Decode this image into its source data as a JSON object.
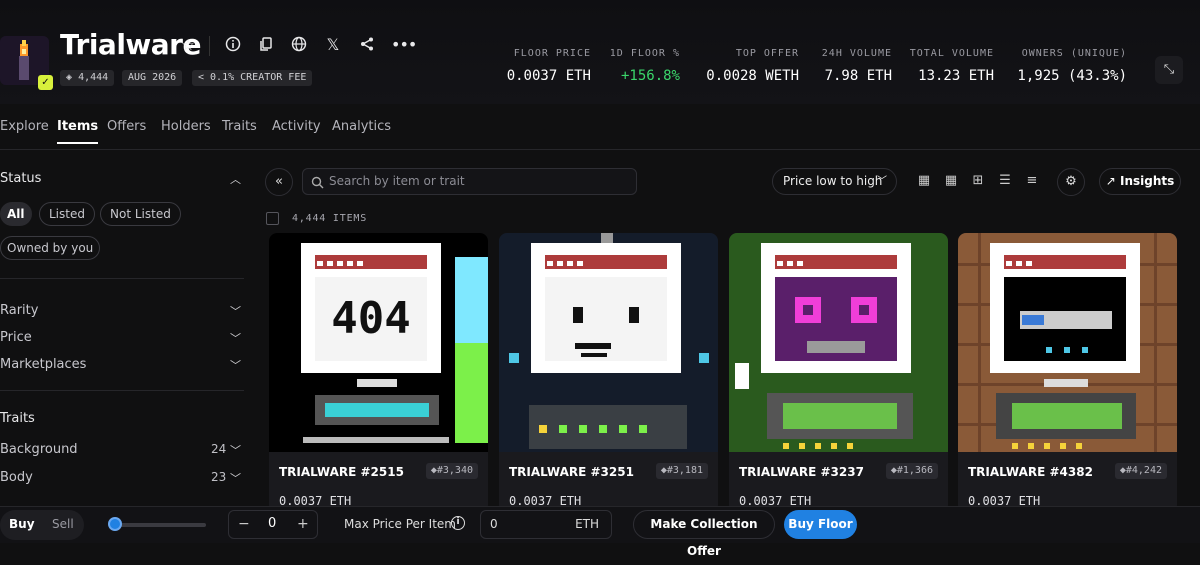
{
  "collection": {
    "title": "Trialware",
    "items_pill": "4,444",
    "date_pill": "AUG 2026",
    "fee_pill": "< 0.1% CREATOR FEE",
    "verify_badge": "✓"
  },
  "stats": [
    {
      "label": "FLOOR PRICE",
      "value": "0.0037 ETH",
      "color": "#ffffff"
    },
    {
      "label": "1D FLOOR %",
      "value": "+156.8%",
      "color": "#3bd66b"
    },
    {
      "label": "TOP OFFER",
      "value": "0.0028 WETH",
      "color": "#ffffff"
    },
    {
      "label": "24H VOLUME",
      "value": "7.98 ETH",
      "color": "#ffffff"
    },
    {
      "label": "TOTAL VOLUME",
      "value": "13.23 ETH",
      "color": "#ffffff"
    },
    {
      "label": "OWNERS (UNIQUE)",
      "value": "1,925 (43.3%)",
      "color": "#ffffff"
    }
  ],
  "header_icons": [
    "star-icon",
    "info-icon",
    "copy-icon",
    "globe-icon",
    "x-logo-icon",
    "share-icon",
    "more-icon"
  ],
  "tabs": [
    "Explore",
    "Items",
    "Offers",
    "Holders",
    "Traits",
    "Activity",
    "Analytics"
  ],
  "active_tab": "Items",
  "sidebar": {
    "status_title": "Status",
    "status_chips": [
      "All",
      "Listed",
      "Not Listed",
      "Owned by you"
    ],
    "filters": [
      "Rarity",
      "Price",
      "Marketplaces"
    ],
    "traits_title": "Traits",
    "traits": [
      {
        "label": "Background",
        "count": "24"
      },
      {
        "label": "Body",
        "count": "23"
      }
    ]
  },
  "toolbar": {
    "search_placeholder": "Search by item or trait",
    "sort_label": "Price low to high",
    "insights_label": "Insights",
    "item_count": "4,444 ITEMS"
  },
  "items": [
    {
      "name": "TRIALWARE #2515",
      "rank": "#3,340",
      "price": "0.0037 ETH",
      "variant": "404"
    },
    {
      "name": "TRIALWARE #3251",
      "rank": "#3,181",
      "price": "0.0037 ETH",
      "variant": "face"
    },
    {
      "name": "TRIALWARE #3237",
      "rank": "#1,366",
      "price": "0.0037 ETH",
      "variant": "purple"
    },
    {
      "name": "TRIALWARE #4382",
      "rank": "#4,242",
      "price": "0.0037 ETH",
      "variant": "loading"
    }
  ],
  "bottom_bar": {
    "buy_label": "Buy",
    "sell_label": "Sell",
    "quantity": "0",
    "minus": "−",
    "plus": "+",
    "max_price_label": "Max Price Per Item",
    "max_price_value": "0",
    "currency": "ETH",
    "offer_button": "Make Collection Offer",
    "buy_floor_button": "Buy Floor"
  },
  "colors": {
    "accent": "#2081e2",
    "positive": "#3bd66b",
    "verify": "#d8f03c"
  }
}
